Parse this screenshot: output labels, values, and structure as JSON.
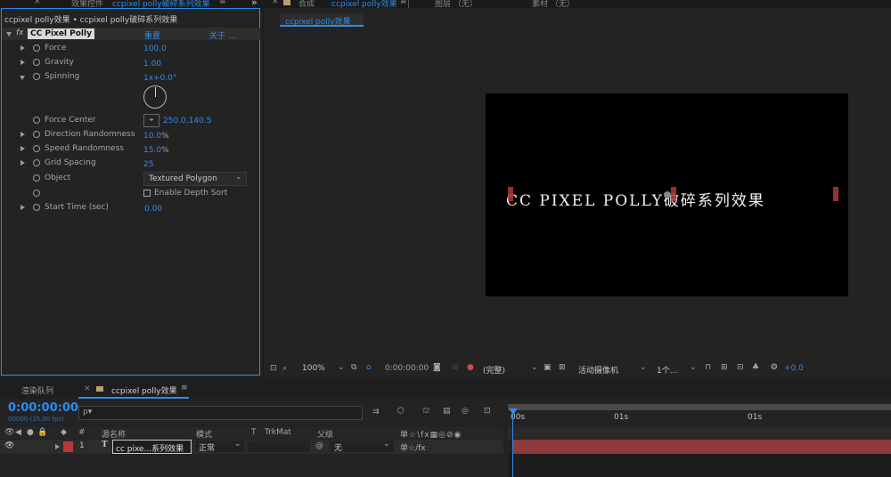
{
  "effect_panel": {
    "tab_label": "效果控件",
    "tab_comp": "ccpixel polly破碎系列效果",
    "breadcrumb": "ccpixel polly效果 • ccpixel polly破碎系列效果",
    "fx_label": "fx",
    "effect_name": "CC Pixel Polly",
    "reset_label": "重置",
    "about_label": "关于 ...",
    "properties": [
      {
        "name": "Force",
        "value": "100.0"
      },
      {
        "name": "Gravity",
        "value": "1.00"
      },
      {
        "name": "Spinning",
        "value": "1x+0.0°"
      },
      {
        "name": "Force Center",
        "value": "250.0,140.5"
      },
      {
        "name": "Direction Randomness",
        "value": "10.0",
        "unit": "%"
      },
      {
        "name": "Speed Randomness",
        "value": "15.0",
        "unit": "%"
      },
      {
        "name": "Grid Spacing",
        "value": "25"
      },
      {
        "name": "Object",
        "value": "Textured Polygon"
      },
      {
        "name": "Enable Depth Sort",
        "value": ""
      },
      {
        "name": "Start Time (sec)",
        "value": "0.00"
      }
    ]
  },
  "viewer": {
    "tab_comp_prefix": "合成",
    "tab_comp": "ccpixel polly效果",
    "tab_layer": "图层 （无）",
    "tab_footage": "素材 （无）",
    "comp_subtab": "ccpixel polly效果",
    "canvas_text": "CC PIXEL POLLY破碎系列效果",
    "toolbar": {
      "zoom": "100%",
      "timecode": "0:00:00:00",
      "resolution": "(完整)",
      "camera": "活动摄像机",
      "views": "1个...",
      "exposure": "+0.0"
    }
  },
  "timeline": {
    "tab_render": "渲染队列",
    "tab_comp": "ccpixel polly效果",
    "timecode": "0:00:00:00",
    "fps": "00000 (25.00 fps)",
    "search_placeholder": "ρ▾",
    "col_num": "#",
    "col_source": "源名称",
    "col_mode": "模式",
    "col_t": "T",
    "col_trkmat": "TrkMat",
    "col_parent": "父级",
    "ruler": [
      "00s",
      "01s",
      "01s"
    ],
    "layer": {
      "index": "1",
      "type": "T",
      "name": "cc pixe...系列效果",
      "mode": "正常",
      "parent": "无"
    }
  },
  "colors": {
    "accent": "#2d8ceb",
    "label_red": "#b23a3a",
    "panel_bg": "#232323"
  }
}
